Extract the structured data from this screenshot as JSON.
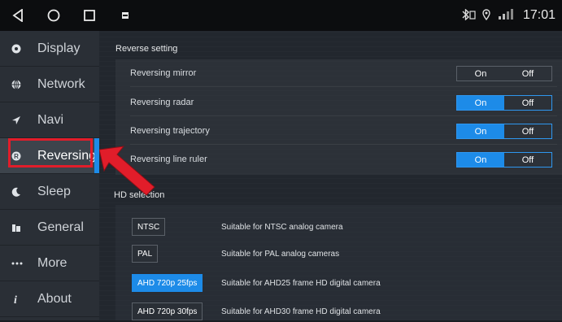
{
  "statusbar": {
    "time": "17:01",
    "nav": [
      "back-icon",
      "home-icon",
      "recents-icon",
      "app-icon"
    ],
    "status_icons": [
      "bluetooth-icon",
      "location-icon",
      "signal-icon"
    ]
  },
  "sidebar": {
    "items": [
      {
        "label": "Display",
        "icon": "display-icon"
      },
      {
        "label": "Network",
        "icon": "globe-icon"
      },
      {
        "label": "Navi",
        "icon": "navigation-arrow-icon"
      },
      {
        "label": "Reversing",
        "icon": "reverse-r-icon"
      },
      {
        "label": "Sleep",
        "icon": "moon-icon"
      },
      {
        "label": "General",
        "icon": "general-icon"
      },
      {
        "label": "More",
        "icon": "more-dots-icon"
      },
      {
        "label": "About",
        "icon": "info-i-icon"
      }
    ],
    "active_index": 3
  },
  "reverse": {
    "title": "Reverse setting",
    "rows": [
      {
        "label": "Reversing mirror",
        "on": "On",
        "off": "Off",
        "value": "Off"
      },
      {
        "label": "Reversing radar",
        "on": "On",
        "off": "Off",
        "value": "On"
      },
      {
        "label": "Reversing trajectory",
        "on": "On",
        "off": "Off",
        "value": "On"
      },
      {
        "label": "Reversing line ruler",
        "on": "On",
        "off": "Off",
        "value": "On"
      }
    ]
  },
  "hd": {
    "title": "HD selection",
    "options": [
      {
        "label": "NTSC",
        "desc": "Suitable for NTSC analog camera",
        "selected": false
      },
      {
        "label": "PAL",
        "desc": "Suitable for PAL analog cameras",
        "selected": false
      },
      {
        "label": "AHD 720p 25fps",
        "desc": "Suitable for AHD25 frame HD digital camera",
        "selected": true
      },
      {
        "label": "AHD 720p 30fps",
        "desc": "Suitable for AHD30 frame HD digital camera",
        "selected": false
      }
    ]
  },
  "colors": {
    "accent": "#1d8be8",
    "highlight_box": "#e11d2a",
    "pointer_arrow": "#e11d2a"
  }
}
